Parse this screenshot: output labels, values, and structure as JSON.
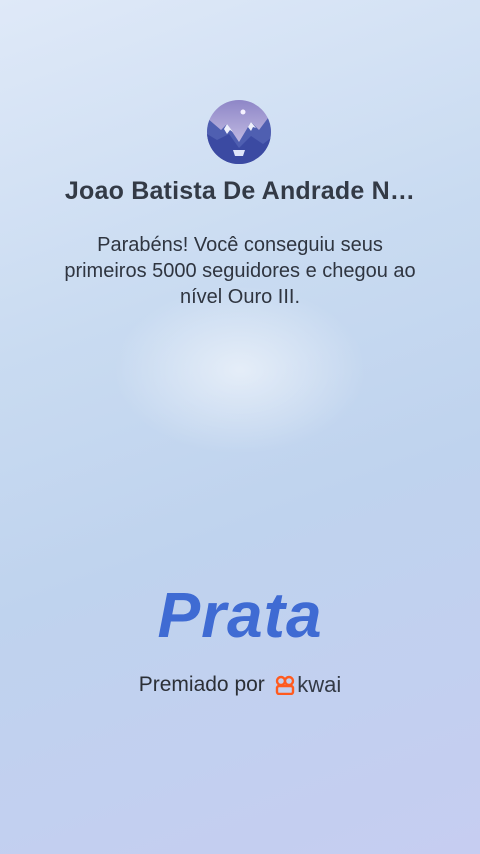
{
  "profile": {
    "username": "Joao Batista De Andrade N…",
    "avatar_icon": "mountain-landscape-avatar"
  },
  "message": {
    "text": "Parabéns! Você conseguiu seus primeiros 5000 seguidores e chegou ao nível Ouro III."
  },
  "tier": {
    "label": "Prata",
    "color": "#3f6bd3"
  },
  "awarded_by": {
    "label": "Premiado por",
    "brand": "kwai",
    "brand_icon": "kwai-logo-icon",
    "brand_color": "#ff5a1f"
  }
}
